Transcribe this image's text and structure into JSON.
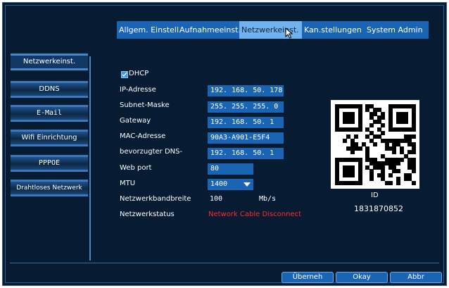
{
  "tabs": [
    "Allgem. Einstell.",
    "Aufnahmeeinst.",
    "Netzwerkeinst.",
    "Kan.stellungen",
    "System Admin"
  ],
  "sidebar": {
    "items": [
      "Netzwerkeinst.",
      "DDNS",
      "E-Mail",
      "Wifi Einrichtung",
      "PPPOE",
      "Drahtloses Netzwerk"
    ]
  },
  "form": {
    "dhcp_label": "DHCP",
    "dhcp_checked": true,
    "ip_label": "IP-Adresse",
    "ip_value": "192. 168.  50. 178",
    "subnet_label": "Subnet-Maske",
    "subnet_value": "255. 255. 255.   0",
    "gateway_label": "Gateway",
    "gateway_value": "192. 168.  50.   1",
    "mac_label": "MAC-Adresse",
    "mac_value": "90A3-A901-E5F4",
    "dns_label": "bevorzugter DNS-",
    "dns_value": "192. 168.  50.   1",
    "webport_label": "Web port",
    "webport_value": "80",
    "mtu_label": "MTU",
    "mtu_value": "1400",
    "bandwidth_label": "Netzwerkbandbreite",
    "bandwidth_value": "100",
    "bandwidth_unit": "Mb/s",
    "status_label": "Netzwerkstatus",
    "status_value": "Network Cable Disconnect",
    "status_color": "#ff2a2a"
  },
  "qr": {
    "id_label": "ID",
    "id_value": "1831870852"
  },
  "buttons": {
    "apply": "Überneh",
    "ok": "Okay",
    "cancel": "Abbr"
  }
}
